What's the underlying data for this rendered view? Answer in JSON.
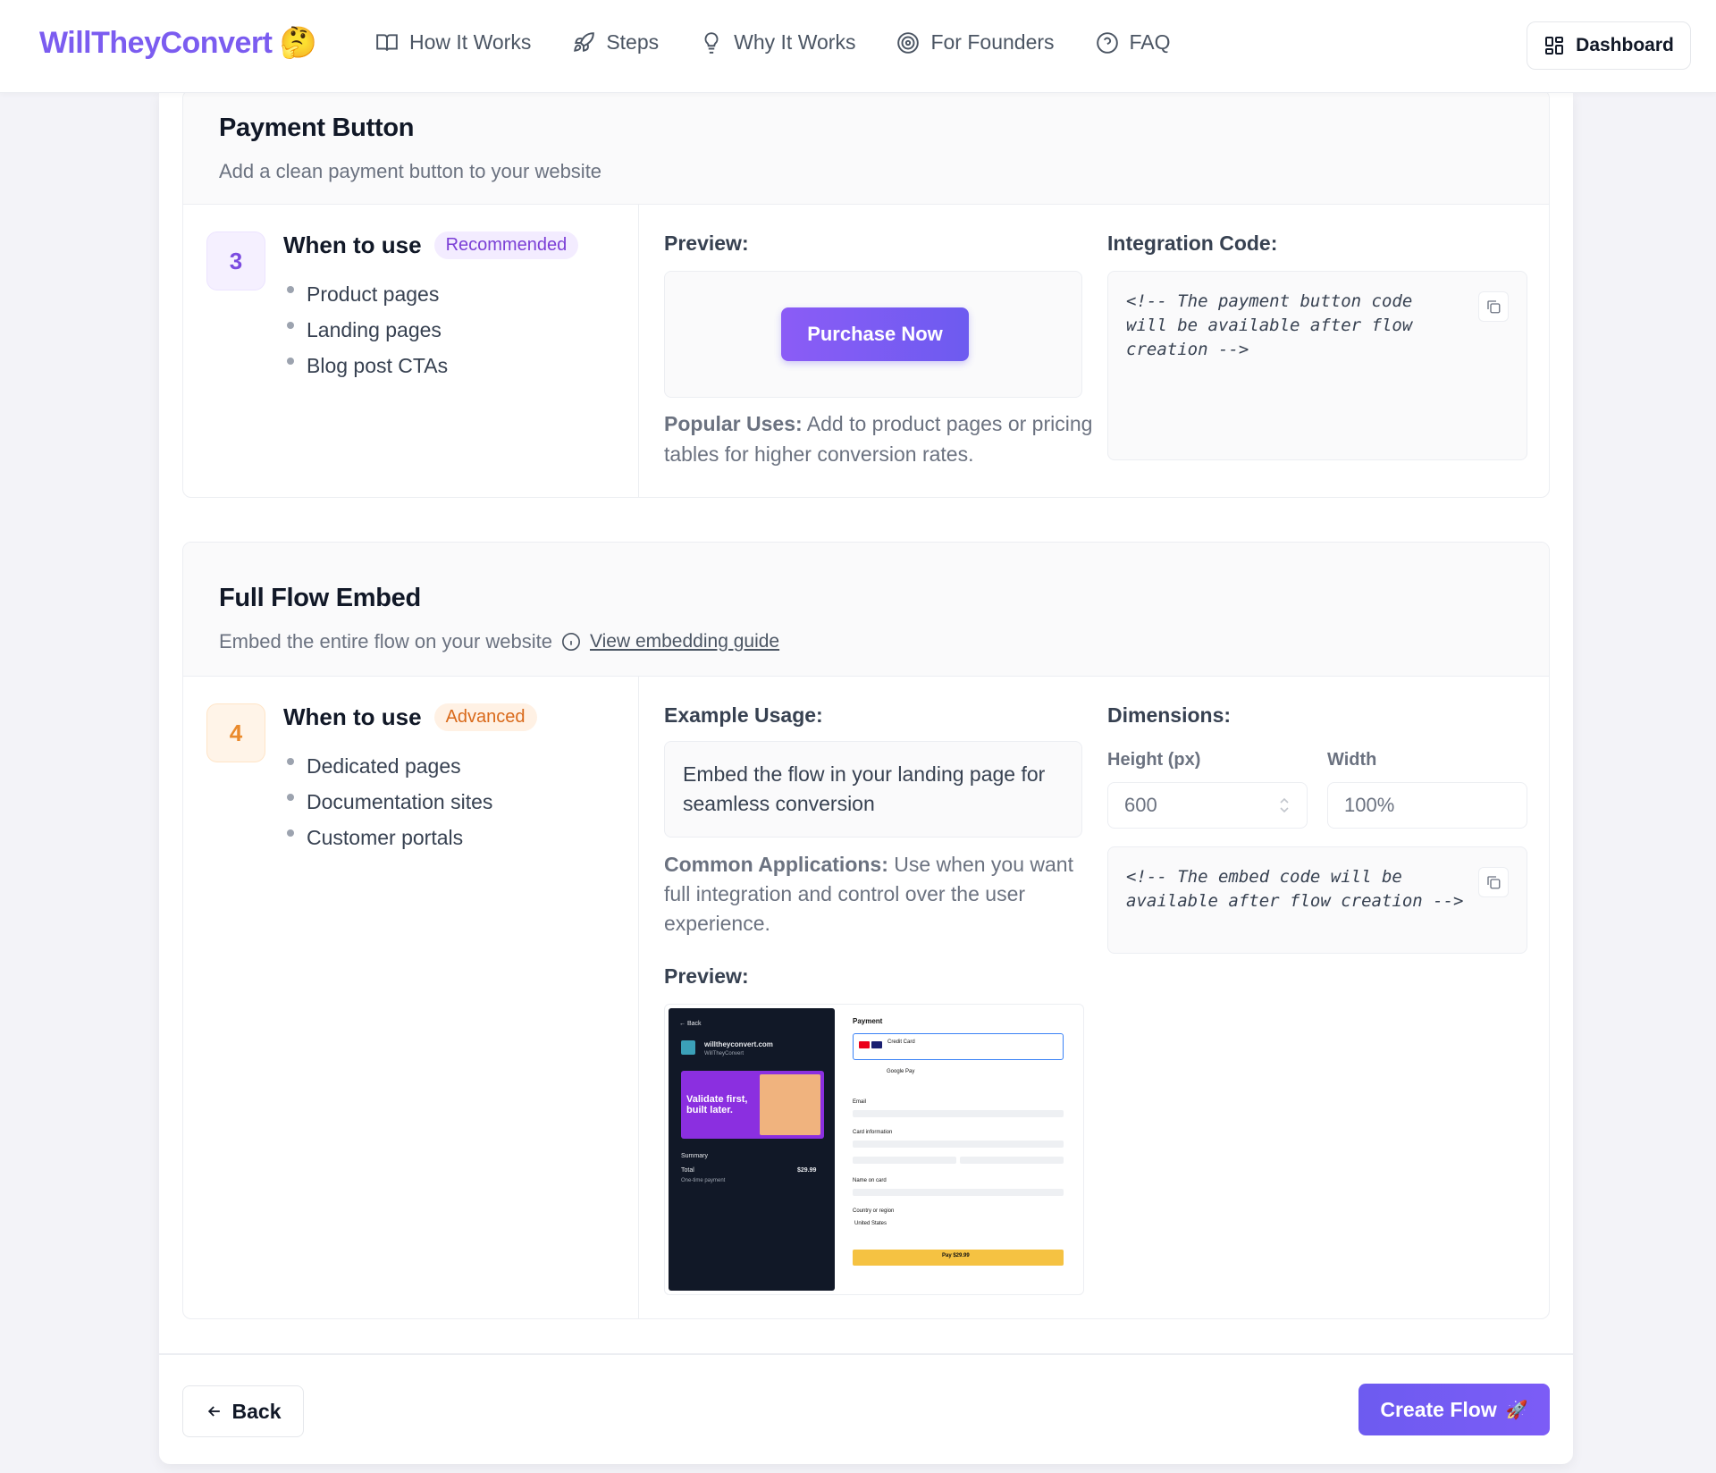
{
  "nav": {
    "logo": "WillTheyConvert",
    "logo_emoji": "🤔",
    "links": [
      {
        "label": "How It Works",
        "icon": "book-icon"
      },
      {
        "label": "Steps",
        "icon": "rocket-icon"
      },
      {
        "label": "Why It Works",
        "icon": "lightbulb-icon"
      },
      {
        "label": "For Founders",
        "icon": "target-icon"
      },
      {
        "label": "FAQ",
        "icon": "help-circle-icon"
      }
    ],
    "dashboard": "Dashboard"
  },
  "payment": {
    "title": "Payment Button",
    "subtitle": "Add a clean payment button to your website",
    "number": "3",
    "when_title": "When to use",
    "tag": "Recommended",
    "uses": [
      "Product pages",
      "Landing pages",
      "Blog post CTAs"
    ],
    "preview_label": "Preview:",
    "button_label": "Purchase Now",
    "popular_label": "Popular Uses:",
    "popular_text": " Add to product pages or pricing tables for higher conversion rates.",
    "code_label": "Integration Code:",
    "code": "<!-- The payment button code will be available after flow creation -->"
  },
  "embed": {
    "title": "Full Flow Embed",
    "subtitle": "Embed the entire flow on your website",
    "guide_link": "View embedding guide",
    "number": "4",
    "when_title": "When to use",
    "tag": "Advanced",
    "uses": [
      "Dedicated pages",
      "Documentation sites",
      "Customer portals"
    ],
    "example_label": "Example Usage:",
    "example_text": "Embed the flow in your landing page for seamless conversion",
    "common_label": "Common Applications:",
    "common_text": " Use when you want full integration and control over the user experience.",
    "preview_label": "Preview:",
    "dimensions_label": "Dimensions:",
    "height_label": "Height (px)",
    "height_value": "600",
    "width_label": "Width",
    "width_value": "100%",
    "code": "<!-- The embed code will be available after flow creation -->",
    "preview_image": {
      "back": "← Back",
      "site": "willtheyconvert.com",
      "site_sub": "WillTheyConvert",
      "hero": "Validate first, built later.",
      "summary": "Summary",
      "total": "Total",
      "total_value": "$29.99",
      "once": "One-time payment",
      "payment": "Payment",
      "card": "Credit Card",
      "gpay": "Google Pay",
      "email": "Email",
      "card_info": "Card information",
      "name": "Name on card",
      "country": "Country or region",
      "country_value": "United States",
      "pay": "Pay $29.99"
    }
  },
  "footer": {
    "back": "Back",
    "create": "Create Flow",
    "create_emoji": "🚀"
  },
  "colors": {
    "brand": "#7b5cf0",
    "primary_button": "#6d5bf0",
    "recommended_tag": "#7b3fd6",
    "advanced_tag": "#d9691a"
  }
}
